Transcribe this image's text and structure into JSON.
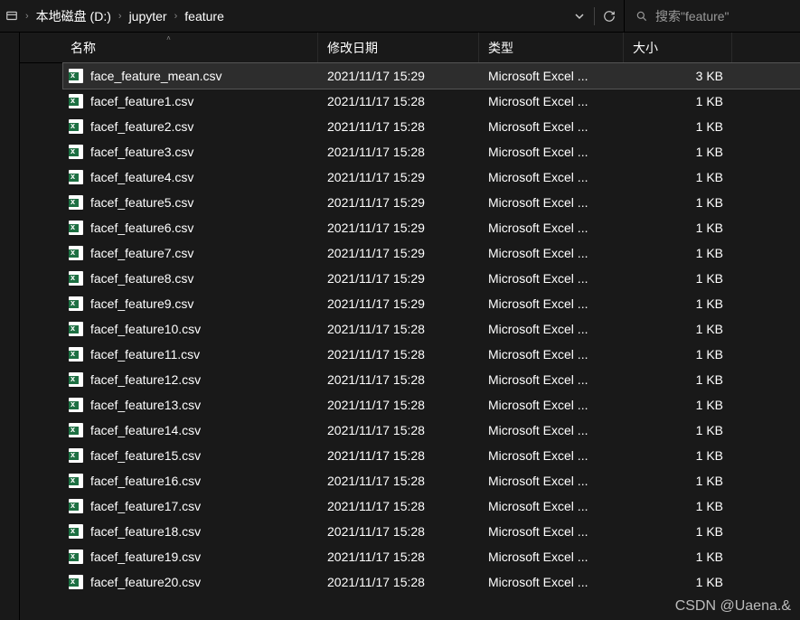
{
  "breadcrumb": {
    "items": [
      "本地磁盘 (D:)",
      "jupyter",
      "feature"
    ]
  },
  "search": {
    "placeholder": "搜索\"feature\""
  },
  "columns": {
    "name": "名称",
    "date": "修改日期",
    "type": "类型",
    "size": "大小"
  },
  "files": [
    {
      "name": "face_feature_mean.csv",
      "date": "2021/11/17 15:29",
      "type": "Microsoft Excel ...",
      "size": "3 KB",
      "selected": true
    },
    {
      "name": "facef_feature1.csv",
      "date": "2021/11/17 15:28",
      "type": "Microsoft Excel ...",
      "size": "1 KB"
    },
    {
      "name": "facef_feature2.csv",
      "date": "2021/11/17 15:28",
      "type": "Microsoft Excel ...",
      "size": "1 KB"
    },
    {
      "name": "facef_feature3.csv",
      "date": "2021/11/17 15:28",
      "type": "Microsoft Excel ...",
      "size": "1 KB"
    },
    {
      "name": "facef_feature4.csv",
      "date": "2021/11/17 15:29",
      "type": "Microsoft Excel ...",
      "size": "1 KB"
    },
    {
      "name": "facef_feature5.csv",
      "date": "2021/11/17 15:29",
      "type": "Microsoft Excel ...",
      "size": "1 KB"
    },
    {
      "name": "facef_feature6.csv",
      "date": "2021/11/17 15:29",
      "type": "Microsoft Excel ...",
      "size": "1 KB"
    },
    {
      "name": "facef_feature7.csv",
      "date": "2021/11/17 15:29",
      "type": "Microsoft Excel ...",
      "size": "1 KB"
    },
    {
      "name": "facef_feature8.csv",
      "date": "2021/11/17 15:29",
      "type": "Microsoft Excel ...",
      "size": "1 KB"
    },
    {
      "name": "facef_feature9.csv",
      "date": "2021/11/17 15:29",
      "type": "Microsoft Excel ...",
      "size": "1 KB"
    },
    {
      "name": "facef_feature10.csv",
      "date": "2021/11/17 15:28",
      "type": "Microsoft Excel ...",
      "size": "1 KB"
    },
    {
      "name": "facef_feature11.csv",
      "date": "2021/11/17 15:28",
      "type": "Microsoft Excel ...",
      "size": "1 KB"
    },
    {
      "name": "facef_feature12.csv",
      "date": "2021/11/17 15:28",
      "type": "Microsoft Excel ...",
      "size": "1 KB"
    },
    {
      "name": "facef_feature13.csv",
      "date": "2021/11/17 15:28",
      "type": "Microsoft Excel ...",
      "size": "1 KB"
    },
    {
      "name": "facef_feature14.csv",
      "date": "2021/11/17 15:28",
      "type": "Microsoft Excel ...",
      "size": "1 KB"
    },
    {
      "name": "facef_feature15.csv",
      "date": "2021/11/17 15:28",
      "type": "Microsoft Excel ...",
      "size": "1 KB"
    },
    {
      "name": "facef_feature16.csv",
      "date": "2021/11/17 15:28",
      "type": "Microsoft Excel ...",
      "size": "1 KB"
    },
    {
      "name": "facef_feature17.csv",
      "date": "2021/11/17 15:28",
      "type": "Microsoft Excel ...",
      "size": "1 KB"
    },
    {
      "name": "facef_feature18.csv",
      "date": "2021/11/17 15:28",
      "type": "Microsoft Excel ...",
      "size": "1 KB"
    },
    {
      "name": "facef_feature19.csv",
      "date": "2021/11/17 15:28",
      "type": "Microsoft Excel ...",
      "size": "1 KB"
    },
    {
      "name": "facef_feature20.csv",
      "date": "2021/11/17 15:28",
      "type": "Microsoft Excel ...",
      "size": "1 KB"
    }
  ],
  "watermark": "CSDN @Uaena.&"
}
